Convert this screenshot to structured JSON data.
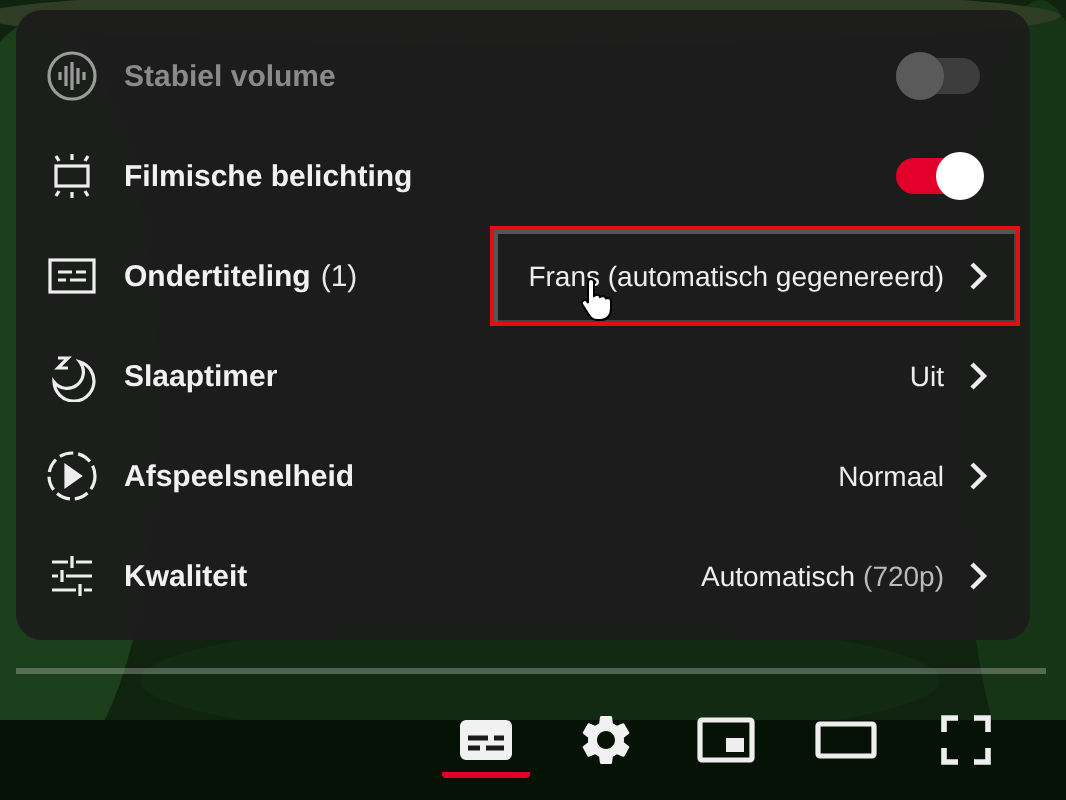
{
  "settings_menu": {
    "items": [
      {
        "kind": "toggle",
        "label": "Stabiel volume",
        "disabled": true,
        "on": false
      },
      {
        "kind": "toggle",
        "label": "Filmische belichting",
        "disabled": false,
        "on": true
      },
      {
        "kind": "submenu",
        "label": "Ondertiteling",
        "count": "(1)",
        "value": "Frans (automatisch gegenereerd)",
        "highlighted": true
      },
      {
        "kind": "submenu",
        "label": "Slaaptimer",
        "value": "Uit",
        "highlighted": false
      },
      {
        "kind": "submenu",
        "label": "Afspeelsnelheid",
        "value": "Normaal",
        "highlighted": false
      },
      {
        "kind": "submenu",
        "label": "Kwaliteit",
        "value": "Automatisch",
        "value_note": "(720p)",
        "highlighted": false
      }
    ]
  },
  "player_controls": [
    {
      "kind": "subtitles",
      "on": true
    },
    {
      "kind": "settings",
      "on": false
    },
    {
      "kind": "miniplayer",
      "on": false
    },
    {
      "kind": "theater",
      "on": false
    },
    {
      "kind": "fullscreen",
      "on": false
    }
  ]
}
